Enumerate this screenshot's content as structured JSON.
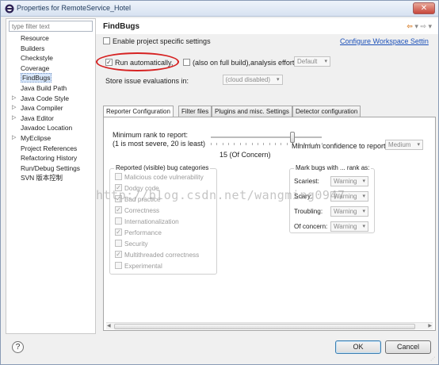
{
  "window": {
    "title": "Properties for RemoteService_Hotel"
  },
  "sidebar": {
    "filter_placeholder": "type filter text",
    "items": [
      {
        "label": "Resource",
        "expandable": false
      },
      {
        "label": "Builders",
        "expandable": false
      },
      {
        "label": "Checkstyle",
        "expandable": false
      },
      {
        "label": "Coverage",
        "expandable": false
      },
      {
        "label": "FindBugs",
        "expandable": false,
        "selected": true
      },
      {
        "label": "Java Build Path",
        "expandable": false
      },
      {
        "label": "Java Code Style",
        "expandable": true
      },
      {
        "label": "Java Compiler",
        "expandable": true
      },
      {
        "label": "Java Editor",
        "expandable": true
      },
      {
        "label": "Javadoc Location",
        "expandable": false
      },
      {
        "label": "MyEclipse",
        "expandable": true
      },
      {
        "label": "Project References",
        "expandable": false
      },
      {
        "label": "Refactoring History",
        "expandable": false
      },
      {
        "label": "Run/Debug Settings",
        "expandable": false
      },
      {
        "label": "SVN 版本控制",
        "expandable": false
      }
    ]
  },
  "main": {
    "title": "FindBugs",
    "enable_specific": "Enable project specific settings",
    "configure_link": "Configure Workspace Settin",
    "run_auto": "Run automatically,",
    "also_full": "(also on full build),",
    "analysis_effort_label": "analysis effort",
    "analysis_effort_value": "Default",
    "store_label": "Store issue evaluations in:",
    "store_value": "(cloud disabled)"
  },
  "tabs": [
    "Reporter Configuration",
    "Filter files",
    "Plugins and misc. Settings",
    "Detector configuration"
  ],
  "reporter": {
    "min_rank_label": "Minimum rank to report:",
    "min_rank_hint": "(1 is most severe, 20 is least)",
    "rank_value_text": "15 (Of Concern)",
    "rank_value": 15,
    "rank_max": 20,
    "min_confidence_label": "Minimum confidence to report:",
    "min_confidence_value": "Medium",
    "categories_title": "Reported (visible) bug categories",
    "categories": [
      {
        "label": "Malicious code vulnerability",
        "checked": false
      },
      {
        "label": "Dodgy code",
        "checked": true
      },
      {
        "label": "Bad practice",
        "checked": true
      },
      {
        "label": "Correctness",
        "checked": true
      },
      {
        "label": "Internationalization",
        "checked": false
      },
      {
        "label": "Performance",
        "checked": true
      },
      {
        "label": "Security",
        "checked": false
      },
      {
        "label": "Multithreaded correctness",
        "checked": true
      },
      {
        "label": "Experimental",
        "checked": false
      }
    ],
    "mark_title": "Mark bugs with ... rank as:",
    "marks": [
      {
        "label": "Scariest:",
        "value": "Warning"
      },
      {
        "label": "Scary:",
        "value": "Warning"
      },
      {
        "label": "Troubling:",
        "value": "Warning"
      },
      {
        "label": "Of concern:",
        "value": "Warning"
      }
    ]
  },
  "buttons": {
    "ok": "OK",
    "cancel": "Cancel",
    "help": "?"
  },
  "watermark": "http://blog.csdn.net/wangming0947",
  "colors": {
    "annotation_circle": "#d62222",
    "link": "#1a4fb8"
  }
}
